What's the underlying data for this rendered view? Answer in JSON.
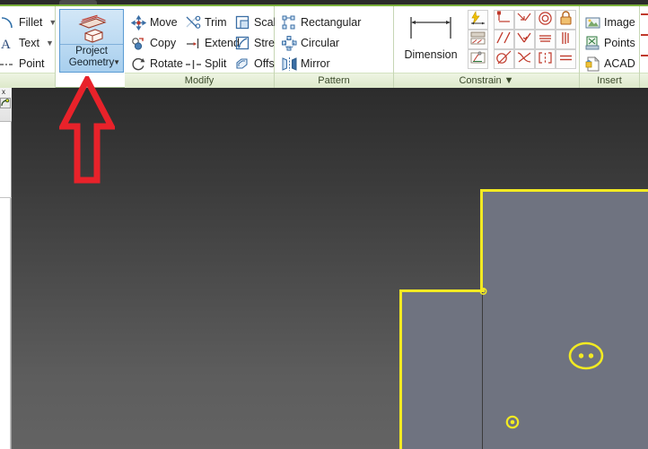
{
  "app": {
    "ribbon_tab_stub": "",
    "accent_green": "#7bb03b",
    "highlight_blue": "#a8cfee",
    "sketch_yellow": "#f2ea22",
    "annotation_red": "#e8222a",
    "canvas_top": "#2c2c2c",
    "canvas_bottom": "#636363"
  },
  "ribbon": {
    "panels": [
      {
        "name": "sketch",
        "label": "",
        "items": [
          {
            "label": "Fillet",
            "icon": "fillet-icon",
            "has_caret": true
          },
          {
            "label": "Text",
            "icon": "text-icon",
            "has_caret": true
          },
          {
            "label": "Point",
            "icon": "point-icon",
            "has_caret": false
          }
        ]
      },
      {
        "name": "modify",
        "label": "Modify",
        "items": [
          {
            "label": "Move",
            "icon": "move-icon"
          },
          {
            "label": "Trim",
            "icon": "trim-icon"
          },
          {
            "label": "Scale",
            "icon": "scale-icon"
          },
          {
            "label": "Copy",
            "icon": "copy-icon"
          },
          {
            "label": "Extend",
            "icon": "extend-icon"
          },
          {
            "label": "Stretch",
            "icon": "stretch-icon"
          },
          {
            "label": "Rotate",
            "icon": "rotate-icon"
          },
          {
            "label": "Split",
            "icon": "split-icon"
          },
          {
            "label": "Offset",
            "icon": "offset-icon"
          }
        ]
      },
      {
        "name": "pattern",
        "label": "Pattern",
        "items": [
          {
            "label": "Rectangular",
            "icon": "rectangular-pattern-icon"
          },
          {
            "label": "Circular",
            "icon": "circular-pattern-icon"
          },
          {
            "label": "Mirror",
            "icon": "mirror-icon"
          }
        ]
      },
      {
        "name": "constrain",
        "label": "Constrain ▼",
        "big_button": {
          "label": "Dimension",
          "icon": "dimension-icon"
        },
        "left_stack": [
          {
            "icon": "auto-dimension-icon"
          },
          {
            "icon": "show-constraints-icon"
          },
          {
            "icon": "constraint-settings-icon"
          }
        ],
        "grid": [
          {
            "icon": "coincident-constraint-icon"
          },
          {
            "icon": "collinear-constraint-icon"
          },
          {
            "icon": "concentric-constraint-icon"
          },
          {
            "icon": "fix-constraint-icon"
          },
          {
            "icon": "parallel-constraint-icon"
          },
          {
            "icon": "perpendicular-constraint-icon"
          },
          {
            "icon": "horizontal-constraint-icon"
          },
          {
            "icon": "vertical-constraint-icon"
          },
          {
            "icon": "tangent-constraint-icon"
          },
          {
            "icon": "smooth-constraint-icon"
          },
          {
            "icon": "symmetric-constraint-icon"
          },
          {
            "icon": "equal-constraint-icon"
          }
        ]
      },
      {
        "name": "insert",
        "label": "Insert",
        "items": [
          {
            "label": "Image",
            "icon": "image-icon"
          },
          {
            "label": "Points",
            "icon": "points-icon"
          },
          {
            "label": "ACAD",
            "icon": "acad-icon"
          }
        ]
      }
    ],
    "project_geometry": {
      "line1": "Project",
      "line2": "Geometry",
      "icon": "project-geometry-icon",
      "selected": true,
      "has_caret": true
    }
  },
  "browser_panel": {
    "close_label": "x",
    "icon": "model-browser-icon"
  },
  "annotation": {
    "arrow": "up-arrow",
    "color": "#e8222a",
    "points_at": "Project Geometry"
  },
  "canvas": {
    "sketch_entities": [
      {
        "name": "projected-edge-upper",
        "type": "polyline",
        "color": "#f2ea22"
      },
      {
        "name": "projected-edge-lower",
        "type": "polyline",
        "color": "#f2ea22"
      },
      {
        "name": "endpoint-marker",
        "type": "point",
        "color": "#f2ea22"
      },
      {
        "name": "projected-slot",
        "type": "ellipse",
        "color": "#f2ea22"
      },
      {
        "name": "projected-hole",
        "type": "circle",
        "color": "#f2ea22"
      }
    ]
  }
}
